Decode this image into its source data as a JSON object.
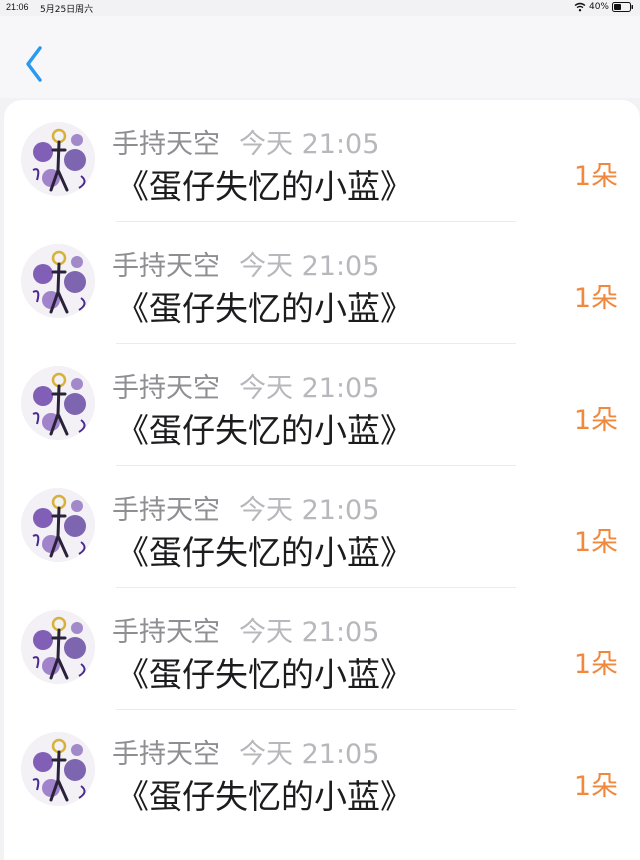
{
  "status_bar": {
    "time": "21:06",
    "date": "5月25日周六",
    "battery": "40%"
  },
  "navigation": {
    "back_icon": "chevron-left-icon",
    "accent_color": "#2a9af0"
  },
  "items": [
    {
      "user_name": "手持天空",
      "time": "今天 21:05",
      "title": "《蛋仔失忆的小蓝》",
      "count": "1朵"
    },
    {
      "user_name": "手持天空",
      "time": "今天 21:05",
      "title": "《蛋仔失忆的小蓝》",
      "count": "1朵"
    },
    {
      "user_name": "手持天空",
      "time": "今天 21:05",
      "title": "《蛋仔失忆的小蓝》",
      "count": "1朵"
    },
    {
      "user_name": "手持天空",
      "time": "今天 21:05",
      "title": "《蛋仔失忆的小蓝》",
      "count": "1朵"
    },
    {
      "user_name": "手持天空",
      "time": "今天 21:05",
      "title": "《蛋仔失忆的小蓝》",
      "count": "1朵"
    },
    {
      "user_name": "手持天空",
      "time": "今天 21:05",
      "title": "《蛋仔失忆的小蓝》",
      "count": "1朵"
    }
  ],
  "colors": {
    "count": "#f0883e",
    "name": "#8e8e93",
    "time": "#b7b7bc"
  }
}
